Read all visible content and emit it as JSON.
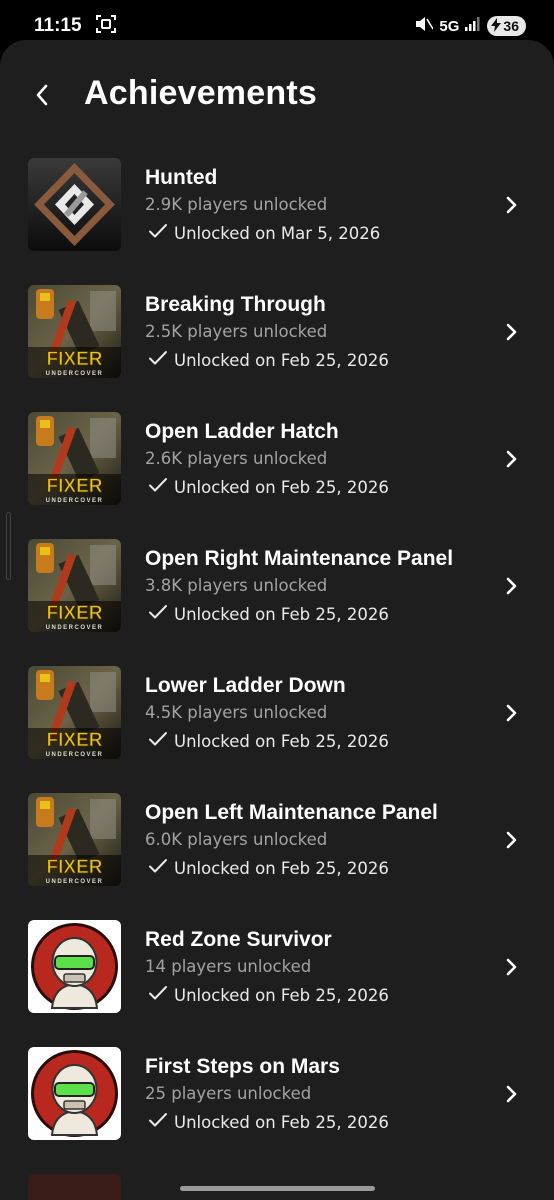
{
  "status_bar": {
    "time": "11:15",
    "network": "5G",
    "battery": "36"
  },
  "header": {
    "title": "Achievements"
  },
  "achievements": [
    {
      "title": "Hunted",
      "players": "2.9K players unlocked",
      "unlocked": "Unlocked on Mar 5, 2026",
      "icon": "hunted-logo-icon"
    },
    {
      "title": "Breaking Through",
      "players": "2.5K players unlocked",
      "unlocked": "Unlocked on Feb 25, 2026",
      "icon": "fixer-undercover-icon"
    },
    {
      "title": "Open Ladder Hatch",
      "players": "2.6K players unlocked",
      "unlocked": "Unlocked on Feb 25, 2026",
      "icon": "fixer-undercover-icon"
    },
    {
      "title": "Open Right Maintenance Panel",
      "players": "3.8K players unlocked",
      "unlocked": "Unlocked on Feb 25, 2026",
      "icon": "fixer-undercover-icon"
    },
    {
      "title": "Lower Ladder Down",
      "players": "4.5K players unlocked",
      "unlocked": "Unlocked on Feb 25, 2026",
      "icon": "fixer-undercover-icon"
    },
    {
      "title": "Open Left Maintenance Panel",
      "players": "6.0K players unlocked",
      "unlocked": "Unlocked on Feb 25, 2026",
      "icon": "fixer-undercover-icon"
    },
    {
      "title": "Red Zone Survivor",
      "players": "14 players unlocked",
      "unlocked": "Unlocked on Feb 25, 2026",
      "icon": "robot-helmet-icon"
    },
    {
      "title": "First Steps on Mars",
      "players": "25 players unlocked",
      "unlocked": "Unlocked on Feb 25, 2026",
      "icon": "robot-helmet-icon"
    }
  ],
  "fixer_logo": {
    "main": "FIXER",
    "sub": "UNDERCOVER"
  },
  "colors": {
    "background": "#1e1e1e",
    "secondary_text": "#a3a3a3",
    "fixer_yellow": "#e8c21a",
    "robot_red": "#b8281e",
    "visor_green": "#5be04a"
  }
}
